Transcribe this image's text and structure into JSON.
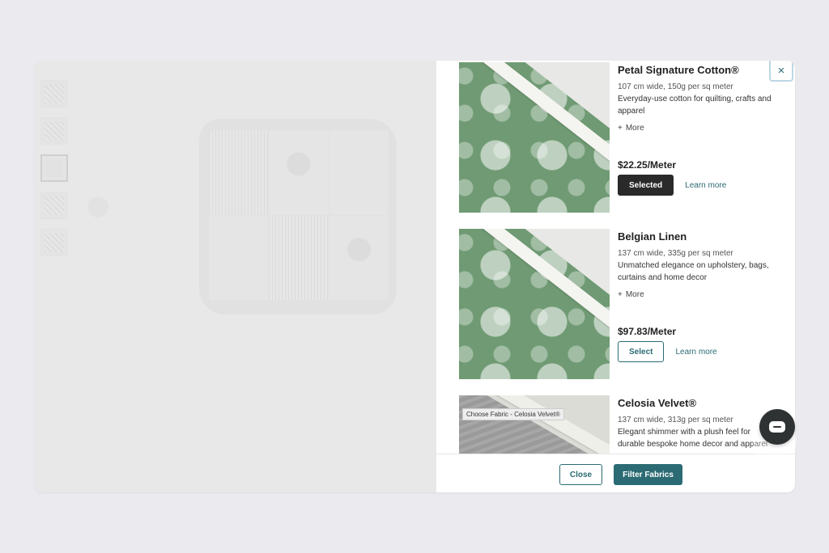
{
  "fabrics": [
    {
      "name": "Petal Signature Cotton®",
      "specs": "107 cm wide, 150g per sq meter",
      "description": "Everyday-use cotton for quilting, crafts and apparel",
      "more_label": "More",
      "price": "$22.25/Meter",
      "button_label": "Selected",
      "learn_more": "Learn more"
    },
    {
      "name": "Belgian Linen",
      "specs": "137 cm wide, 335g per sq meter",
      "description": "Unmatched elegance on upholstery, bags, curtains and home decor",
      "more_label": "More",
      "price": "$97.83/Meter",
      "button_label": "Select",
      "learn_more": "Learn more"
    },
    {
      "name": "Celosia Velvet®",
      "specs": "137 cm wide, 313g per sq meter",
      "description": "Elegant shimmer with a plush feel for durable bespoke home decor and apparel",
      "image_caption": "Choose Fabric - Celosia Velvet®"
    }
  ],
  "footer": {
    "close_label": "Close",
    "filter_label": "Filter Fabrics"
  },
  "close_icon": "×",
  "icons": {
    "more": "+",
    "close": "close-icon",
    "chat": "chat-icon"
  },
  "colors": {
    "accent": "#2c6b73",
    "selected_button": "#2a2a2a",
    "chat_button": "#2e3233"
  }
}
